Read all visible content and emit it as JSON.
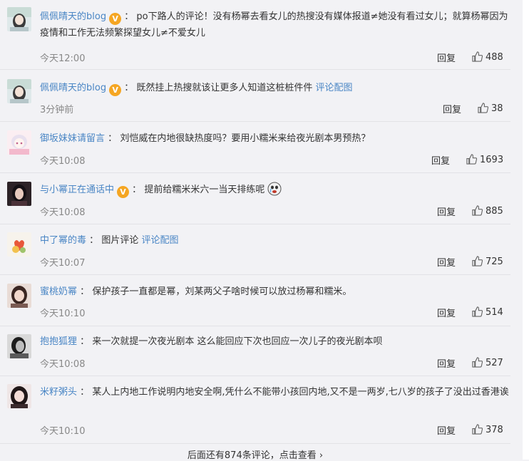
{
  "comments": [
    {
      "username": "佩佩晴天的blog",
      "verified": true,
      "text": "po下路人的评论！没有杨幂去看女儿的热搜没有媒体报道≠她没有看过女儿；就算杨幂因为疫情和工作无法频繁探望女儿≠不爱女儿",
      "link": "",
      "time": "今天12:00",
      "reply": "回复",
      "likes": "488"
    },
    {
      "username": "佩佩晴天的blog",
      "verified": true,
      "text": "既然挂上热搜就该让更多人知道这桩桩件件",
      "link": "评论配图",
      "time": "3分钟前",
      "reply": "回复",
      "likes": "38"
    },
    {
      "username": "御坂妹妹请留言",
      "verified": false,
      "text": "刘恺威在内地很缺热度吗？要用小糯米来给夜光剧本男预热？",
      "link": "",
      "time": "今天10:08",
      "reply": "回复",
      "likes": "1693"
    },
    {
      "username": "与小幂正在通话中",
      "verified": true,
      "text": "提前给糯米米六一当天排练呢",
      "link": "",
      "time": "今天10:08",
      "reply": "回复",
      "likes": "885"
    },
    {
      "username": "中了幂的毒",
      "verified": false,
      "text": "图片评论",
      "link": "评论配图",
      "time": "今天10:07",
      "reply": "回复",
      "likes": "725"
    },
    {
      "username": "蜜桃奶幂",
      "verified": false,
      "text": "保护孩子一直都是幂，刘某两父子啥时候可以放过杨幂和糯米。",
      "link": "",
      "time": "今天10:10",
      "reply": "回复",
      "likes": "514"
    },
    {
      "username": "抱抱狐狸",
      "verified": false,
      "text": "来一次就提一次夜光剧本 这么能回应下次也回应一次儿子的夜光剧本呗",
      "link": "",
      "time": "今天10:08",
      "reply": "回复",
      "likes": "527"
    },
    {
      "username": "米籽粥头",
      "verified": false,
      "text": "某人上内地工作说明内地安全啊,凭什么不能带小孩回内地,又不是一两岁,七八岁的孩子了没出过香港诶",
      "link": "",
      "time": "今天10:10",
      "reply": "回复",
      "likes": "378"
    }
  ],
  "separator": "：",
  "footer": {
    "text": "后面还有874条评论，点击查看",
    "arrow": "›"
  },
  "colors": {
    "username": "#4a86c5",
    "background": "#f2f2f5",
    "verified_badge": "#f5a623"
  }
}
